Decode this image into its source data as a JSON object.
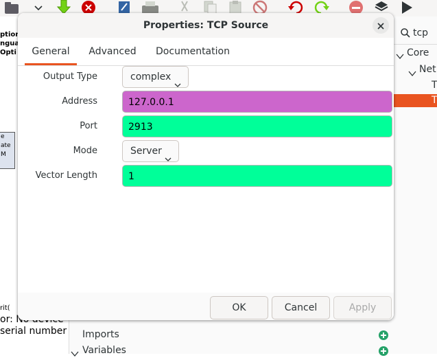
{
  "background": {
    "left_panel_fragments": {
      "options_lines": [
        "ption",
        "ngua",
        "Opti"
      ],
      "block_lines": [
        "e",
        "ate",
        "M"
      ],
      "console_lines": [
        "rit(",
        "or: No device",
        "serial number"
      ]
    },
    "block_tree": {
      "search_text": "tcp",
      "items": [
        {
          "label": "Core"
        },
        {
          "label": "Net"
        },
        {
          "label": "T"
        },
        {
          "label": "T"
        }
      ]
    },
    "variables_panel": {
      "items": [
        {
          "label": "Imports"
        },
        {
          "label": "Variables"
        }
      ]
    },
    "colors": {
      "selection": "#e95420",
      "add_button": "#26a269"
    }
  },
  "dialog": {
    "title": "Properties: TCP Source",
    "tabs": [
      {
        "label": "General",
        "active": true
      },
      {
        "label": "Advanced",
        "active": false
      },
      {
        "label": "Documentation",
        "active": false
      }
    ],
    "fields": {
      "output_type": {
        "label": "Output Type",
        "value": "complex"
      },
      "address": {
        "label": "Address",
        "value": "127.0.0.1",
        "color": "#cc66cc"
      },
      "port": {
        "label": "Port",
        "value": "2913",
        "color": "#00ff99"
      },
      "mode": {
        "label": "Mode",
        "value": "Server"
      },
      "vector_length": {
        "label": "Vector Length",
        "value": "1",
        "color": "#00ff99"
      }
    },
    "buttons": {
      "ok": "OK",
      "cancel": "Cancel",
      "apply": "Apply"
    }
  }
}
